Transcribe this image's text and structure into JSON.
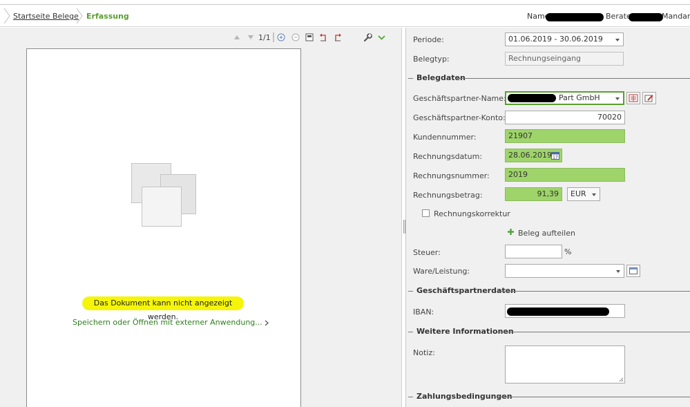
{
  "breadcrumb": {
    "home": "Startseite Belege",
    "current": "Erfassung"
  },
  "header": {
    "name_label": "Name:",
    "berater_label": "Berater",
    "mandant_label": "Mandant"
  },
  "viewer": {
    "page_info": "1/1",
    "message": "Das Dokument kann nicht angezeigt werden.",
    "external_link": "Speichern oder Öffnen mit externer Anwendung..."
  },
  "form": {
    "periode": {
      "label": "Periode:",
      "value": "01.06.2019 - 30.06.2019"
    },
    "belegtyp": {
      "label": "Belegtyp:",
      "value": "Rechnungseingang"
    },
    "section_belegdaten": "Belegdaten",
    "gp_name": {
      "label": "Geschäftspartner-Name:",
      "value": "Part GmbH"
    },
    "gp_konto": {
      "label": "Geschäftspartner-Konto:",
      "value": "70020"
    },
    "kundennummer": {
      "label": "Kundennummer:",
      "value": "21907"
    },
    "rechnungsdatum": {
      "label": "Rechnungsdatum:",
      "value": "28.06.2019"
    },
    "rechnungsnummer": {
      "label": "Rechnungsnummer:",
      "value": "2019"
    },
    "rechnungsbetrag": {
      "label": "Rechnungsbetrag:",
      "value": "91,39",
      "currency": "EUR"
    },
    "rechnungskorrektur": {
      "label": "Rechnungskorrektur",
      "checked": false
    },
    "beleg_aufteilen": "Beleg aufteilen",
    "steuer": {
      "label": "Steuer:",
      "value": "",
      "unit": "%"
    },
    "ware": {
      "label": "Ware/Leistung:",
      "value": ""
    },
    "section_gpdaten": "Geschäftspartnerdaten",
    "iban": {
      "label": "IBAN:"
    },
    "section_weitere": "Weitere Informationen",
    "notiz": {
      "label": "Notiz:",
      "value": ""
    },
    "section_zahlung": "Zahlungsbedingungen"
  },
  "colors": {
    "accent_green": "#5a9e2c",
    "field_green": "#9ed46a",
    "highlight_yellow": "#f5f50a",
    "link_green": "#2e7d1e"
  },
  "icons": [
    "chevron-right-icon",
    "arrow-up-icon",
    "arrow-down-icon",
    "zoom-in-icon",
    "zoom-out-icon",
    "fit-page-icon",
    "rotate-left-icon",
    "rotate-right-icon",
    "wrench-icon",
    "chevron-down-icon",
    "calendar-icon",
    "plus-icon",
    "address-book-icon",
    "edit-icon",
    "list-icon"
  ]
}
